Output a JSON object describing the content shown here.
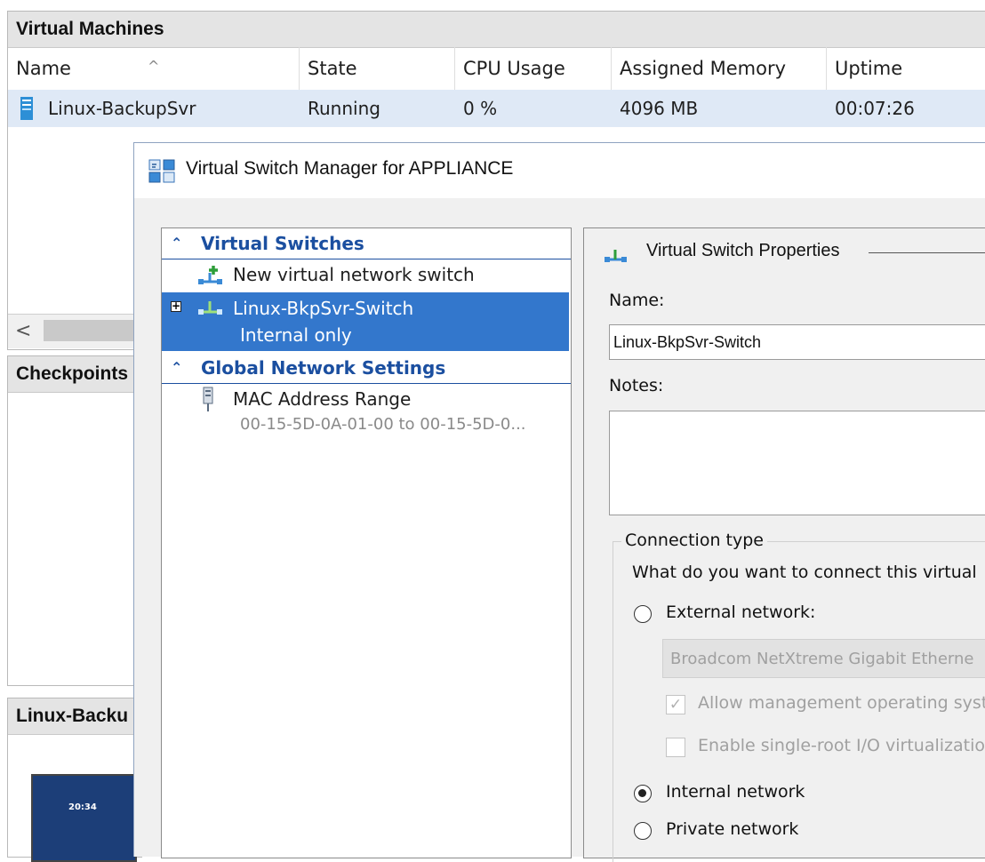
{
  "vm_panel": {
    "title": "Virtual Machines",
    "columns": [
      "Name",
      "State",
      "CPU Usage",
      "Assigned Memory",
      "Uptime"
    ],
    "row": {
      "name": "Linux-BackupSvr",
      "state": "Running",
      "cpu": "0 %",
      "memory": "4096 MB",
      "uptime": "00:07:26"
    }
  },
  "checkpoints_panel": {
    "title": "Checkpoints"
  },
  "vm_detail_panel": {
    "title": "Linux-Backu",
    "thumbnail_time": "20:34"
  },
  "dialog": {
    "title": "Virtual Switch Manager for APPLIANCE",
    "tree": {
      "virtual_switches_header": "Virtual Switches",
      "new_switch_label": "New virtual network switch",
      "switch_name": "Linux-BkpSvr-Switch",
      "switch_subtitle": "Internal only",
      "global_header": "Global Network Settings",
      "mac_label": "MAC Address Range",
      "mac_value": "00-15-5D-0A-01-00 to 00-15-5D-0..."
    },
    "properties": {
      "section_title": "Virtual Switch Properties",
      "name_label": "Name:",
      "name_value": "Linux-BkpSvr-Switch",
      "notes_label": "Notes:",
      "notes_value": "",
      "connection_type_label": "Connection type",
      "connection_question": "What do you want to connect this virtual",
      "external_label": "External network:",
      "adapter_value": "Broadcom NetXtreme Gigabit Etherne",
      "allow_mgmt_label": "Allow management operating syst",
      "allow_mgmt_checked": true,
      "sriov_label": "Enable single-root I/O virtualizatio",
      "sriov_checked": false,
      "internal_label": "Internal network",
      "private_label": "Private network",
      "selected_connection": "internal"
    }
  },
  "colors": {
    "selection": "#3377cc",
    "section_header": "#1b4fa0",
    "row_highlight": "#dfe9f6"
  }
}
